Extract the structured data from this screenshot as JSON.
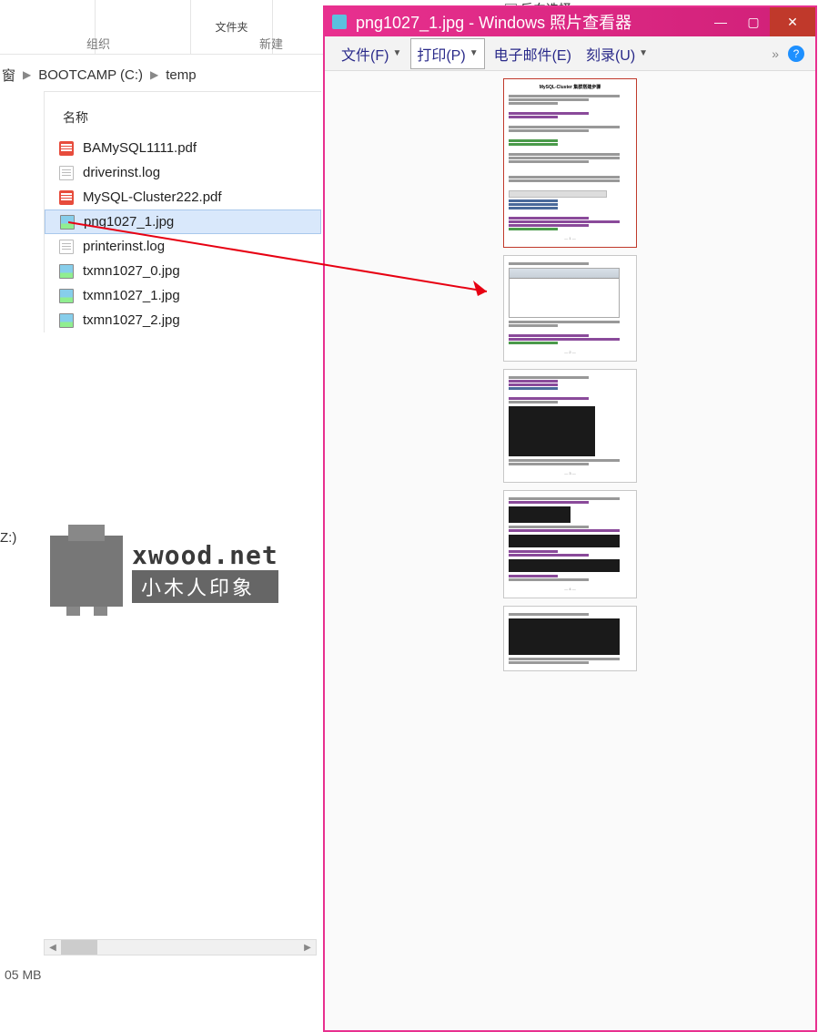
{
  "explorer": {
    "top_labels": {
      "organize": "组织",
      "new": "新建",
      "folder": "文件夹"
    },
    "breadcrumb": {
      "item0": "窗",
      "item1": "BOOTCAMP (C:)",
      "item2": "temp"
    },
    "column_header": "名称",
    "files": [
      {
        "name": "BAMySQL1111.pdf",
        "type": "pdf"
      },
      {
        "name": "driverinst.log",
        "type": "log"
      },
      {
        "name": "MySQL-Cluster222.pdf",
        "type": "pdf"
      },
      {
        "name": "png1027_1.jpg",
        "type": "img"
      },
      {
        "name": "printerinst.log",
        "type": "log"
      },
      {
        "name": "txmn1027_0.jpg",
        "type": "img"
      },
      {
        "name": "txmn1027_1.jpg",
        "type": "img"
      },
      {
        "name": "txmn1027_2.jpg",
        "type": "img"
      }
    ],
    "left_label": "Z:)",
    "status": "05 MB"
  },
  "watermark": {
    "domain": "xwood.net",
    "chinese": "小木人印象"
  },
  "viewer": {
    "title": "png1027_1.jpg - Windows 照片查看器",
    "menu": {
      "file": "文件(F)",
      "print": "打印(P)",
      "email": "电子邮件(E)",
      "burn": "刻录(U)"
    },
    "preview_title": "MySQL-Cluster 集群搭建步骤"
  },
  "top_right": {
    "invert_select": "反向选择"
  }
}
